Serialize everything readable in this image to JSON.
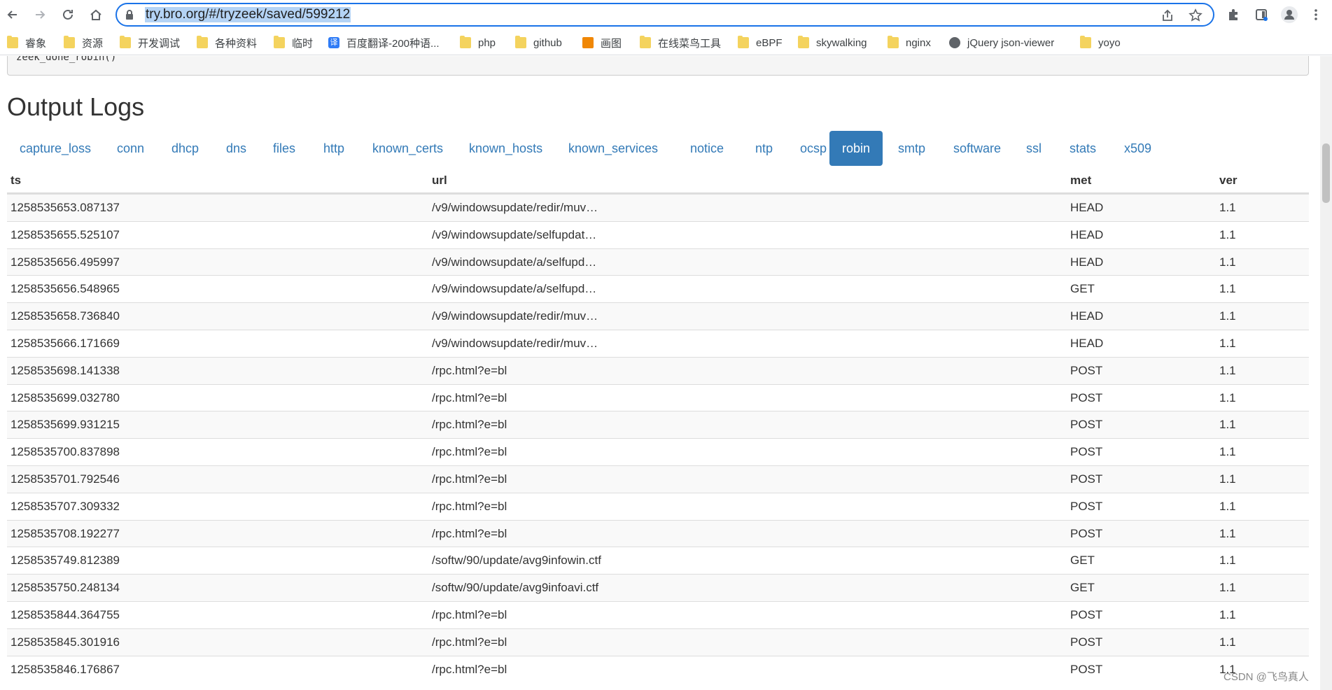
{
  "browser": {
    "url": "try.bro.org/#/tryzeek/saved/599212",
    "bookmarks": [
      {
        "label": "睿象",
        "icon": "folder-icon"
      },
      {
        "label": "资源",
        "icon": "folder-icon"
      },
      {
        "label": "开发调试",
        "icon": "folder-icon"
      },
      {
        "label": "各种资料",
        "icon": "folder-icon"
      },
      {
        "label": "临时",
        "icon": "folder-icon"
      },
      {
        "label": "百度翻译-200种语...",
        "icon": "translate-icon"
      },
      {
        "label": "php",
        "icon": "folder-icon"
      },
      {
        "label": "github",
        "icon": "folder-icon"
      },
      {
        "label": "画图",
        "icon": "drawio-icon"
      },
      {
        "label": "在线菜鸟工具",
        "icon": "folder-icon"
      },
      {
        "label": "eBPF",
        "icon": "folder-icon"
      },
      {
        "label": "skywalking",
        "icon": "folder-icon"
      },
      {
        "label": "nginx",
        "icon": "folder-icon"
      },
      {
        "label": "jQuery json-viewer",
        "icon": "globe-icon"
      },
      {
        "label": "yoyo",
        "icon": "folder-icon"
      }
    ]
  },
  "page": {
    "code_snippet": "zeek_done_robin()",
    "heading": "Output Logs",
    "tabs": [
      "capture_loss",
      "conn",
      "dhcp",
      "dns",
      "files",
      "http",
      "known_certs",
      "known_hosts",
      "known_services",
      "notice",
      "ntp",
      "ocsp",
      "robin",
      "smtp",
      "software",
      "ssl",
      "stats",
      "x509"
    ],
    "active_tab": "robin",
    "table": {
      "columns": [
        "ts",
        "url",
        "met",
        "ver"
      ],
      "rows": [
        [
          "1258535653.087137",
          "/v9/windowsupdate/redir/muv…",
          "HEAD",
          "1.1"
        ],
        [
          "1258535655.525107",
          "/v9/windowsupdate/selfupdat…",
          "HEAD",
          "1.1"
        ],
        [
          "1258535656.495997",
          "/v9/windowsupdate/a/selfupd…",
          "HEAD",
          "1.1"
        ],
        [
          "1258535656.548965",
          "/v9/windowsupdate/a/selfupd…",
          "GET",
          "1.1"
        ],
        [
          "1258535658.736840",
          "/v9/windowsupdate/redir/muv…",
          "HEAD",
          "1.1"
        ],
        [
          "1258535666.171669",
          "/v9/windowsupdate/redir/muv…",
          "HEAD",
          "1.1"
        ],
        [
          "1258535698.141338",
          "/rpc.html?e=bl",
          "POST",
          "1.1"
        ],
        [
          "1258535699.032780",
          "/rpc.html?e=bl",
          "POST",
          "1.1"
        ],
        [
          "1258535699.931215",
          "/rpc.html?e=bl",
          "POST",
          "1.1"
        ],
        [
          "1258535700.837898",
          "/rpc.html?e=bl",
          "POST",
          "1.1"
        ],
        [
          "1258535701.792546",
          "/rpc.html?e=bl",
          "POST",
          "1.1"
        ],
        [
          "1258535707.309332",
          "/rpc.html?e=bl",
          "POST",
          "1.1"
        ],
        [
          "1258535708.192277",
          "/rpc.html?e=bl",
          "POST",
          "1.1"
        ],
        [
          "1258535749.812389",
          "/softw/90/update/avg9infowin.ctf",
          "GET",
          "1.1"
        ],
        [
          "1258535750.248134",
          "/softw/90/update/avg9infoavi.ctf",
          "GET",
          "1.1"
        ],
        [
          "1258535844.364755",
          "/rpc.html?e=bl",
          "POST",
          "1.1"
        ],
        [
          "1258535845.301916",
          "/rpc.html?e=bl",
          "POST",
          "1.1"
        ],
        [
          "1258535846.176867",
          "/rpc.html?e=bl",
          "POST",
          "1.1"
        ]
      ]
    }
  },
  "watermark": "CSDN @飞鸟真人",
  "colors": {
    "accent": "#337ab7",
    "omnibox_border": "#1a73e8"
  }
}
